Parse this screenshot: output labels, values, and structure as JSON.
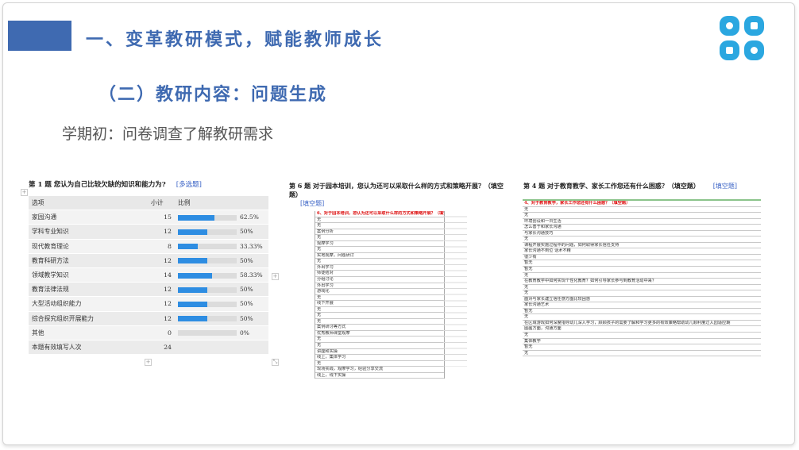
{
  "slide": {
    "title": "一、变革教研模式，赋能教师成长",
    "subtitle": "（二）教研内容：问题生成",
    "caption": "学期初：问卷调查了解教研需求"
  },
  "colors": {
    "accent": "#3f6ab1",
    "logo": "#2ba7e0",
    "bar": "#2e8de2"
  },
  "q1": {
    "title": "第 1 题   您认为自己比较欠缺的知识和能力为?",
    "tag": "[多选题]",
    "headers": [
      "选项",
      "小计",
      "比例"
    ],
    "rows": [
      {
        "option": "家园沟通",
        "count": "15",
        "pct": "62.5%",
        "ratio": 0.625
      },
      {
        "option": "学科专业知识",
        "count": "12",
        "pct": "50%",
        "ratio": 0.5
      },
      {
        "option": "现代教育理论",
        "count": "8",
        "pct": "33.33%",
        "ratio": 0.3333
      },
      {
        "option": "教育科研方法",
        "count": "12",
        "pct": "50%",
        "ratio": 0.5
      },
      {
        "option": "领域教学知识",
        "count": "14",
        "pct": "58.33%",
        "ratio": 0.5833
      },
      {
        "option": "教育法律法规",
        "count": "12",
        "pct": "50%",
        "ratio": 0.5
      },
      {
        "option": "大型活动组织能力",
        "count": "12",
        "pct": "50%",
        "ratio": 0.5
      },
      {
        "option": "综合探究组织开展能力",
        "count": "12",
        "pct": "50%",
        "ratio": 0.5
      },
      {
        "option": "其他",
        "count": "0",
        "pct": "0%",
        "ratio": 0
      }
    ],
    "total_label": "本题有效填写人次",
    "total": "24"
  },
  "q2": {
    "title": "第 6 题   对于园本培训，您认为还可以采取什么样的方式和策略开展？（填空题）",
    "tag": "[填空题]",
    "sheet_header": "6、对于园本培训，您认为还可以采取什么样的方式和策略开展？（填空题）",
    "answers": [
      "无",
      "无",
      "案例分析",
      "无",
      "观摩学习",
      "无",
      "实地观摩，问题研讨",
      "无",
      "外出学习",
      "师徒结对",
      "分组讨论",
      "外出学习",
      "游戏化",
      "无",
      "线下开展",
      "无",
      "无",
      "无",
      "案例研讨等方式",
      "优秀教师课堂观摩",
      "无",
      "无",
      "讲座和实操",
      "线上，集体学习",
      "无",
      "现场实践，观摩学习，经验分享交流",
      "线上，线下实操"
    ]
  },
  "q3": {
    "title": "第 4 题   对于教育教学、家长工作您还有什么困惑？（填空题）",
    "tag": "[填空题]",
    "sheet_header": "4、对于教育教学，家长工作您还有什么困惑？（填空题）",
    "answers": [
      "无",
      "无",
      "环境创设和一日生活",
      "怎么善于和家长沟通",
      "与家长沟通技巧",
      "无",
      "课程开展实施过程中的问题，如何取得家长信任支持",
      "家长沟通不到位 话术不精",
      "很少有",
      "暂无",
      "暂无",
      "无",
      "在教育教学中如何实现个性化教育？如何引导家长参与到教育活动中来？",
      "无",
      "无",
      "面对与家长建立信任感方面比较困惑",
      "家长沟通艺术",
      "暂无",
      "无",
      "在区域游戏如何深度指导幼儿深入学习，顾顾孩子的需要了解和学习更多的有效策略帮助幼儿顺利度过入园适应期",
      "图画方面，沟通方面",
      "无",
      "集体教学",
      "暂无",
      "无"
    ]
  }
}
